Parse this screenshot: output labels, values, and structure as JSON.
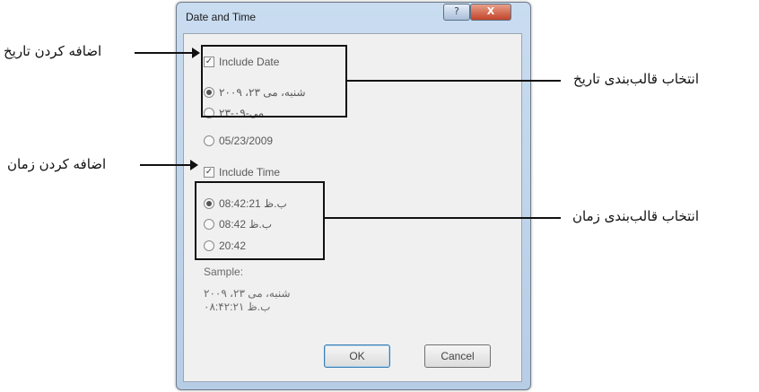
{
  "annotations": {
    "add_date": "اضافه کردن تاریخ",
    "date_format": "انتخاب قالب‌بندی تاریخ",
    "add_time": "اضافه کردن زمان",
    "time_format": "انتخاب قالب‌بندی زمان"
  },
  "dialog": {
    "title": "Date and Time",
    "close_glyph": "X",
    "help_glyph": "?",
    "include_date": {
      "label": "Include Date",
      "checked": true
    },
    "date_formats": [
      {
        "label": "شنبه، می ۲۳، ۲۰۰۹",
        "selected": true
      },
      {
        "label": "۲۳-می-۰۹",
        "selected": false
      },
      {
        "label": "05/23/2009",
        "selected": false
      }
    ],
    "include_time": {
      "label": "Include Time",
      "checked": true
    },
    "time_formats": [
      {
        "label": "08:42:21 ب.ظ",
        "selected": true
      },
      {
        "label": "08:42 ب.ظ",
        "selected": false
      },
      {
        "label": "20:42",
        "selected": false
      }
    ],
    "sample_label": "Sample:",
    "sample_line1": "شنبه، می ۲۳، ۲۰۰۹",
    "sample_line2": "ب.ظ ۰۸:۴۲:۲۱",
    "ok_label": "OK",
    "cancel_label": "Cancel"
  },
  "colors": {
    "frame": "#b7cde6",
    "client": "#f0f0f0",
    "close": "#c2442a"
  }
}
